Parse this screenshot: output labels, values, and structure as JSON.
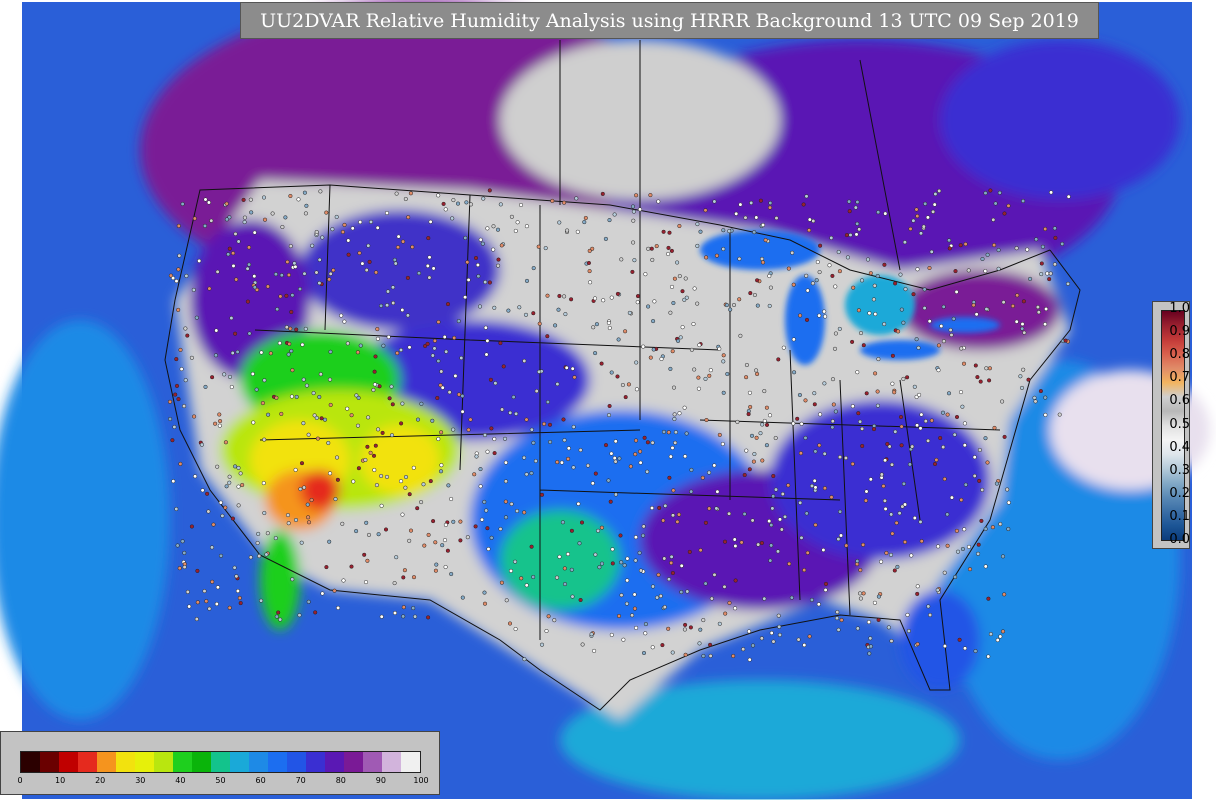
{
  "title": "UU2DVAR Relative Humidity Analysis using HRRR Background 13 UTC 09 Sep 2019",
  "legend": {
    "labels": [
      "1.0",
      "0.9",
      "0.8",
      "0.7",
      "0.6",
      "0.5",
      "0.4",
      "0.3",
      "0.2",
      "0.1",
      "0.0"
    ],
    "colors": [
      "#67001f",
      "#99202f",
      "#c33a38",
      "#d9604d",
      "#e08b68",
      "#f2b45f",
      "#cfcfcf",
      "#b8b8b8",
      "#e0e0e0",
      "#f4f4f4",
      "#dfe6ec",
      "#b5cbda",
      "#84aac7",
      "#5a8ab6",
      "#3a6ea6",
      "#1c5596",
      "#0b3c7b"
    ]
  },
  "rh_scale": {
    "ticks": [
      "0",
      "10",
      "20",
      "30",
      "40",
      "50",
      "60",
      "70",
      "80",
      "90",
      "100"
    ],
    "colors": [
      "#2b0000",
      "#6a0000",
      "#c00000",
      "#e52a1e",
      "#f5941e",
      "#f2e20e",
      "#e6f00a",
      "#b9e60f",
      "#1ecf1e",
      "#0ab40a",
      "#13c38c",
      "#1aa9d8",
      "#1e8ae6",
      "#1c6ef0",
      "#2255e6",
      "#3a2fd2",
      "#5a18b4",
      "#7a1a96",
      "#a05ab4",
      "#d2b4dc",
      "#f0f0f0"
    ]
  }
}
